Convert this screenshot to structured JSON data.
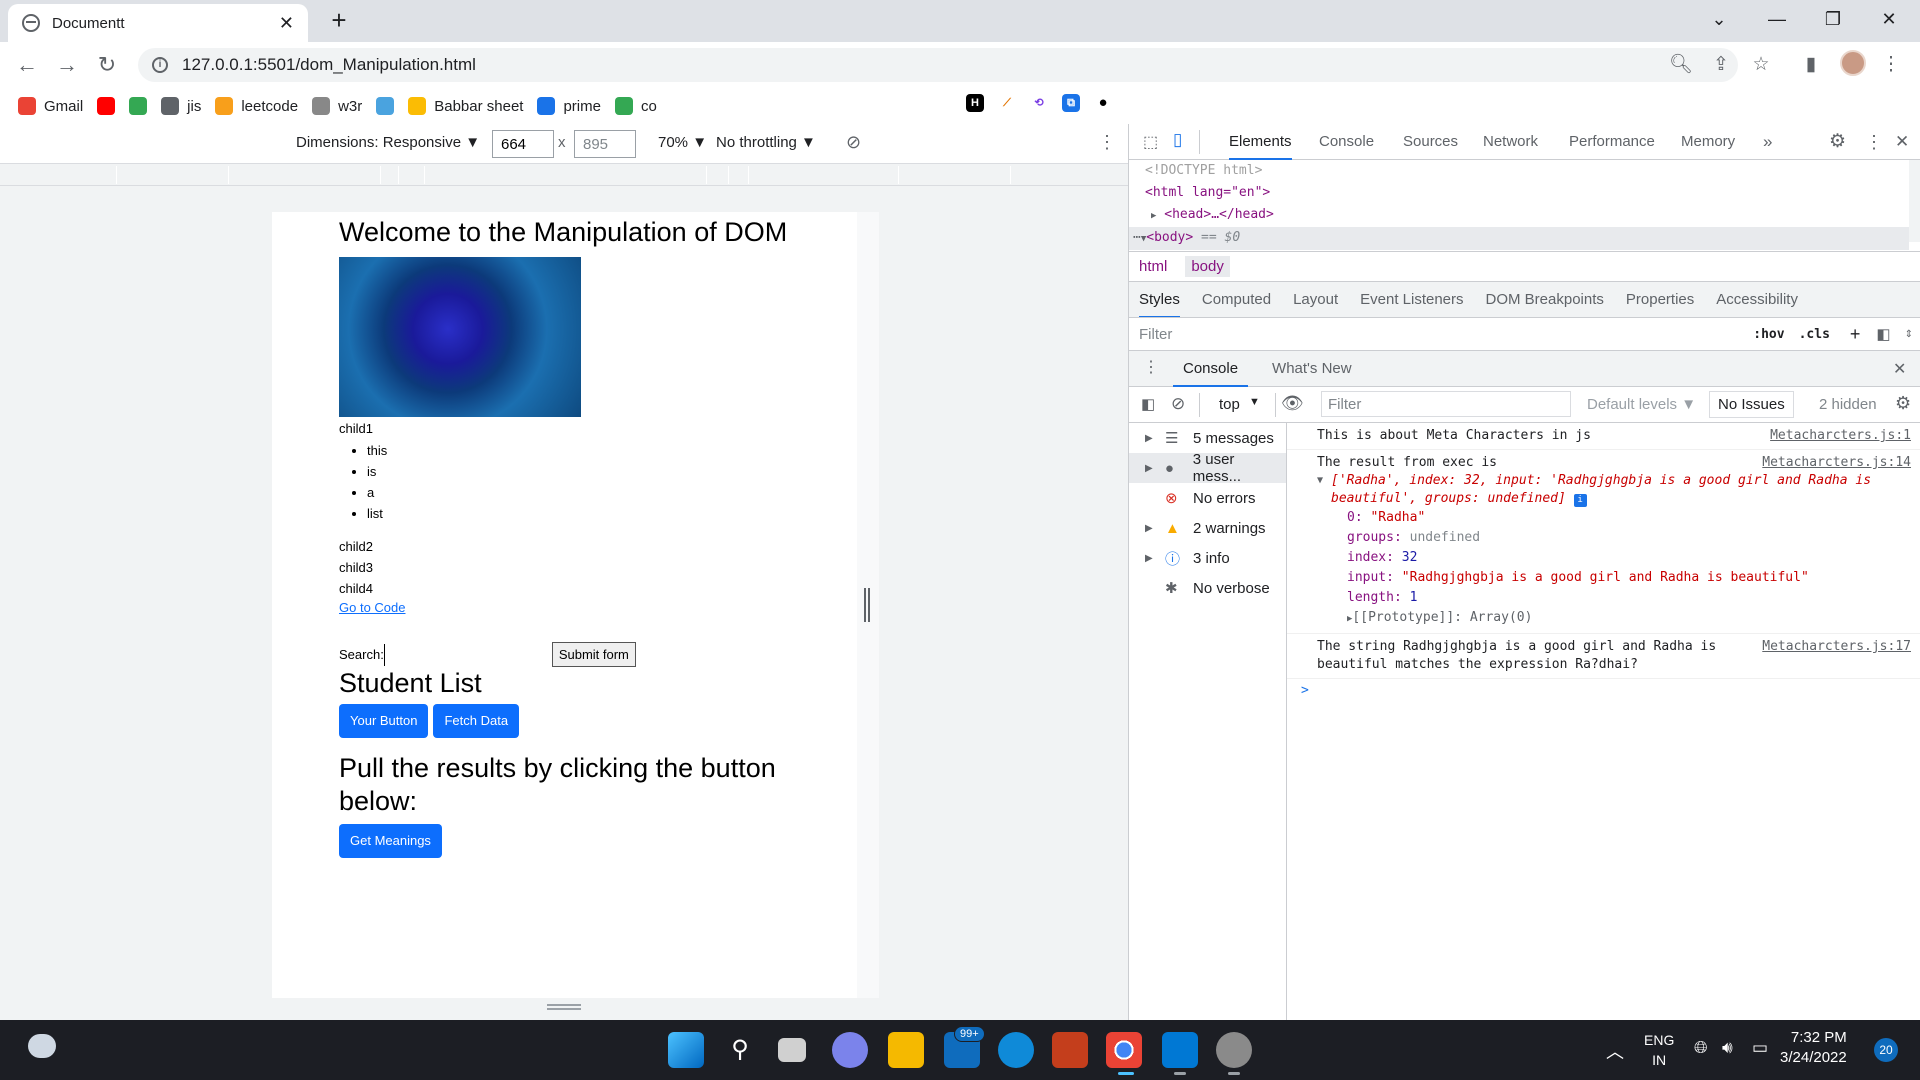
{
  "browser": {
    "tab_title": "Documentt",
    "url": "127.0.0.1:5501/dom_Manipulation.html",
    "bookmarks": [
      {
        "label": "Gmail",
        "icon": "gmail-icon",
        "color": "#ea4335"
      },
      {
        "label": "",
        "icon": "youtube-icon",
        "color": "#ff0000"
      },
      {
        "label": "",
        "icon": "maps-icon",
        "color": "#34a853"
      },
      {
        "label": "jis",
        "icon": "globe-icon",
        "color": "#5f6368"
      },
      {
        "label": "leetcode",
        "icon": "leetcode-icon",
        "color": "#f89f1b"
      },
      {
        "label": "w3r",
        "icon": "w3r-icon",
        "color": "#888888"
      },
      {
        "label": "",
        "icon": "bookmark-icon",
        "color": "#4aa3df"
      },
      {
        "label": "Babbar sheet",
        "icon": "drive-icon",
        "color": "#fbbc04"
      },
      {
        "label": "prime",
        "icon": "prime-icon",
        "color": "#1a73e8"
      },
      {
        "label": "co",
        "icon": "drive-icon",
        "color": "#34a853"
      }
    ]
  },
  "device_toolbar": {
    "dimensions_label": "Dimensions: Responsive ▼",
    "width": "664",
    "height": "895",
    "zoom": "70% ▼",
    "throttling": "No throttling ▼"
  },
  "page": {
    "heading1": "Welcome to the Manipulation of DOM",
    "child1": "child1",
    "list": [
      "this",
      "is",
      "a",
      "list"
    ],
    "child2": "child2",
    "child3": "child3",
    "child4": "child4",
    "link": "Go to Code",
    "search_label": "Search:",
    "submit": "Submit form",
    "heading2": "Student List",
    "btn_your": "Your Button",
    "btn_fetch": "Fetch Data",
    "heading3": "Pull the results by clicking the button below:",
    "btn_meanings": "Get Meanings"
  },
  "devtools": {
    "tabs": [
      "Elements",
      "Console",
      "Sources",
      "Network",
      "Performance",
      "Memory"
    ],
    "dom": {
      "doctype": "<!DOCTYPE html>",
      "html_open": "<html lang=\"en\">",
      "head": "<head>…</head>",
      "body": "<body>",
      "body_suffix": "== $0"
    },
    "breadcrumb": [
      "html",
      "body"
    ],
    "styles_tabs": [
      "Styles",
      "Computed",
      "Layout",
      "Event Listeners",
      "DOM Breakpoints",
      "Properties",
      "Accessibility"
    ],
    "styles_filter": "Filter",
    "hov": ":hov",
    "cls": ".cls",
    "drawer_tabs": [
      "Console",
      "What's New"
    ],
    "console_context": "top",
    "console_filter": "Filter",
    "default_levels": "Default levels ▼",
    "no_issues": "No Issues",
    "hidden": "2 hidden",
    "sidebar": [
      {
        "label": "5 messages",
        "icon": "list-icon"
      },
      {
        "label": "3 user mess...",
        "icon": "user-icon"
      },
      {
        "label": "No errors",
        "icon": "error-icon"
      },
      {
        "label": "2 warnings",
        "icon": "warning-icon"
      },
      {
        "label": "3 info",
        "icon": "info-icon"
      },
      {
        "label": "No verbose",
        "icon": "bug-icon"
      }
    ],
    "messages": {
      "m1_text": "This is about Meta Characters in js",
      "m1_src": "Metacharcters.js:1",
      "m2_text": "The result from exec is",
      "m2_src": "Metacharcters.js:14",
      "m2_array": "['Radha', index: 32, input: 'Radhgjghgbja is a good girl and Radha is beautiful', groups: undefined]",
      "m2_props": [
        {
          "k": "0",
          "v": "\"Radha\""
        },
        {
          "k": "groups",
          "v": "undefined"
        },
        {
          "k": "index",
          "v": "32"
        },
        {
          "k": "input",
          "v": "\"Radhgjghgbja is a good girl and Radha is beautiful\""
        },
        {
          "k": "length",
          "v": "1"
        }
      ],
      "m2_proto": "[[Prototype]]: Array(0)",
      "m3_text": "The string Radhgjghgbja is a good girl and Radha is beautiful matches the expression Ra?dhai?",
      "m3_src": "Metacharcters.js:17",
      "prompt": ">"
    }
  },
  "taskbar": {
    "time": "7:32 PM",
    "date": "3/24/2022",
    "lang1": "ENG",
    "lang2": "IN",
    "mail_badge": "99+",
    "notif_count": "20"
  }
}
